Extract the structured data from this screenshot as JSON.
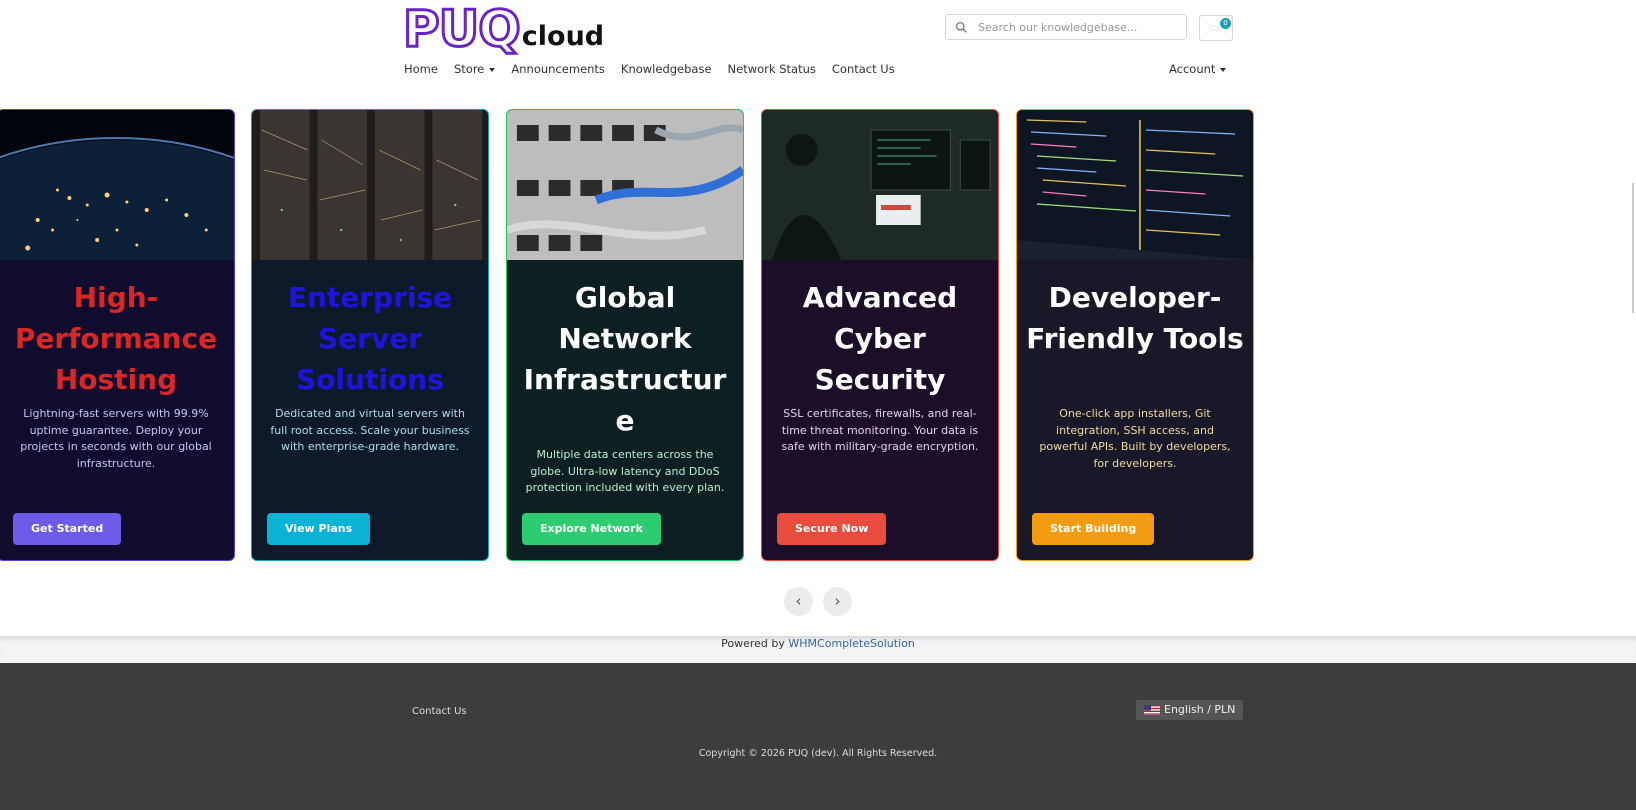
{
  "brand": {
    "logo_main": "PUQ",
    "logo_sub": "cloud"
  },
  "search": {
    "placeholder": "Search our knowledgebase..."
  },
  "cart": {
    "count": "0"
  },
  "nav": {
    "items": [
      "Home",
      "Store",
      "Announcements",
      "Knowledgebase",
      "Network Status",
      "Contact Us"
    ],
    "account": "Account"
  },
  "cards": [
    {
      "title": "High-Performance Hosting",
      "desc": "Lightning-fast servers with 99.9% uptime guarantee. Deploy your projects in seconds with our global infrastructure.",
      "button": "Get Started",
      "title_color": "#dc2626",
      "desc_color": "#c6c6f0",
      "bg": "#0f0c2e",
      "border": "#5b3fd6",
      "btn_color": "#6c5ce7"
    },
    {
      "title": "Enterprise Server Solutions",
      "desc": "Dedicated and virtual servers with full root access. Scale your business with enterprise-grade hardware.",
      "button": "View Plans",
      "title_color": "#1e14e0",
      "desc_color": "#a9def0",
      "bg": "#0e1a2a",
      "border": "#17a2b8",
      "btn_color": "#0ab3d6"
    },
    {
      "title": "Global Network Infrastructure",
      "desc": "Multiple data centers across the globe. Ultra-low latency and DDoS protection included with every plan.",
      "button": "Explore Network",
      "title_color": "#ffffff",
      "desc_color": "#b8efd0",
      "bg": "#0c1f22",
      "border": "#22c55e",
      "btn_color": "#2ecc71"
    },
    {
      "title": "Advanced Cyber Security",
      "desc": "SSL certificates, firewalls, and real-time threat monitoring. Your data is safe with military-grade encryption.",
      "button": "Secure Now",
      "title_color": "#ffffff",
      "desc_color": "#e6d0f0",
      "bg": "#1c0d28",
      "border": "#e74c3c",
      "btn_color": "#e74c3c"
    },
    {
      "title": "Developer-Friendly Tools",
      "desc": "One-click app installers, Git integration, SSH access, and powerful APIs. Built by developers, for developers.",
      "button": "Start Building",
      "title_color": "#ffffff",
      "desc_color": "#f3d9a4",
      "bg": "#181829",
      "border": "#f39c12",
      "btn_color": "#f39c12"
    }
  ],
  "carousel": {
    "prev": "‹",
    "next": "›"
  },
  "powered": {
    "text": "Powered by ",
    "link": "WHMCompleteSolution"
  },
  "footer": {
    "contact": "Contact Us",
    "language": "English / PLN",
    "copyright": "Copyright © 2026 PUQ (dev). All Rights Reserved."
  }
}
